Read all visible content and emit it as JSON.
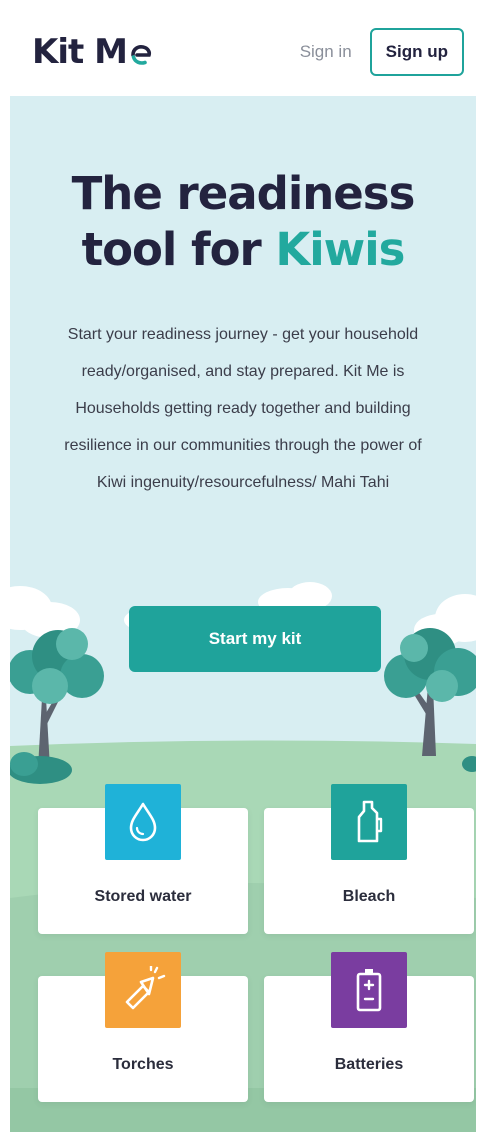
{
  "header": {
    "logo_text": "Kit M",
    "signin_label": "Sign in",
    "signup_label": "Sign up"
  },
  "hero": {
    "title_line1": "The readiness",
    "title_line2_prefix": "tool for ",
    "title_line2_accent": "Kiwis",
    "description": "Start your readiness journey - get your household ready/organised, and stay prepared. Kit Me is Households getting ready together and building resilience in our communities through the power of Kiwi ingenuity/resourcefulness/ Mahi Tahi",
    "cta_label": "Start my kit"
  },
  "cards": [
    {
      "label": "Stored water",
      "icon": "water-drop-icon",
      "color": "#1fb2d8"
    },
    {
      "label": "Bleach",
      "icon": "bleach-bottle-icon",
      "color": "#1fa39b"
    },
    {
      "label": "Torches",
      "icon": "torch-icon",
      "color": "#f5a23a"
    },
    {
      "label": "Batteries",
      "icon": "battery-icon",
      "color": "#7a3da0"
    }
  ],
  "colors": {
    "brand_teal": "#1fa39b",
    "accent_teal": "#22a99e",
    "navy": "#23233f",
    "sky": "#d8eef2",
    "grass": "#a8d5b4"
  }
}
